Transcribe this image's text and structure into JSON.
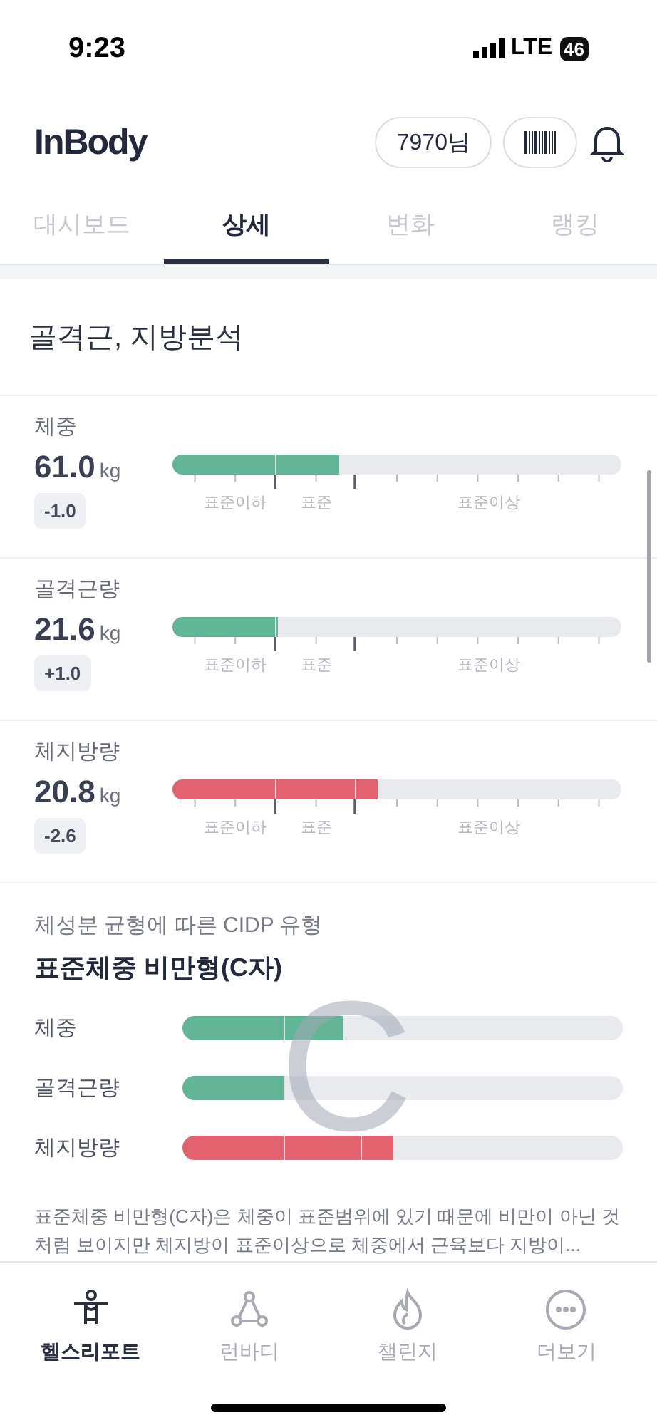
{
  "status_bar": {
    "time": "9:23",
    "network": "LTE",
    "battery": "46"
  },
  "header": {
    "logo": "InBody",
    "user_chip": "7970님"
  },
  "tabs": [
    {
      "label": "대시보드",
      "selected": false
    },
    {
      "label": "상세",
      "selected": true
    },
    {
      "label": "변화",
      "selected": false
    },
    {
      "label": "랭킹",
      "selected": false
    }
  ],
  "section_title": "골격근, 지방분석",
  "metrics": [
    {
      "name": "체중",
      "value": "61.0",
      "unit": "kg",
      "change": "-1.0",
      "level": 0.37,
      "color": "#63b597",
      "scale_labels": [
        "표준이하",
        "표준",
        "표준이상"
      ]
    },
    {
      "name": "골격근량",
      "value": "21.6",
      "unit": "kg",
      "change": "+1.0",
      "level": 0.235,
      "color": "#63b597",
      "scale_labels": [
        "표준이하",
        "표준",
        "표준이상"
      ]
    },
    {
      "name": "체지방량",
      "value": "20.8",
      "unit": "kg",
      "change": "-2.6",
      "level": 0.457,
      "color": "#e2636f",
      "scale_labels": [
        "표준이하",
        "표준",
        "표준이상"
      ]
    }
  ],
  "cidp": {
    "caption": "체성분 균형에 따른 CIDP 유형",
    "type_title": "표준체중 비만형(C자)",
    "shape_letter": "C",
    "bars": [
      {
        "name": "체중",
        "level": 0.367,
        "color": "#63b597"
      },
      {
        "name": "골격근량",
        "level": 0.234,
        "color": "#63b597"
      },
      {
        "name": "체지방량",
        "level": 0.48,
        "color": "#e2636f"
      }
    ],
    "description": "표준체중 비만형(C자)은 체중이 표준범위에 있기 때문에 비만이 아닌 것처럼 보이지만 체지방이 표준이상으로 체중에서 근육보다 지방이..."
  },
  "bottom_nav": [
    {
      "label": "헬스리포트",
      "selected": true
    },
    {
      "label": "런바디",
      "selected": false
    },
    {
      "label": "챌린지",
      "selected": false
    },
    {
      "label": "더보기",
      "selected": false
    }
  ]
}
